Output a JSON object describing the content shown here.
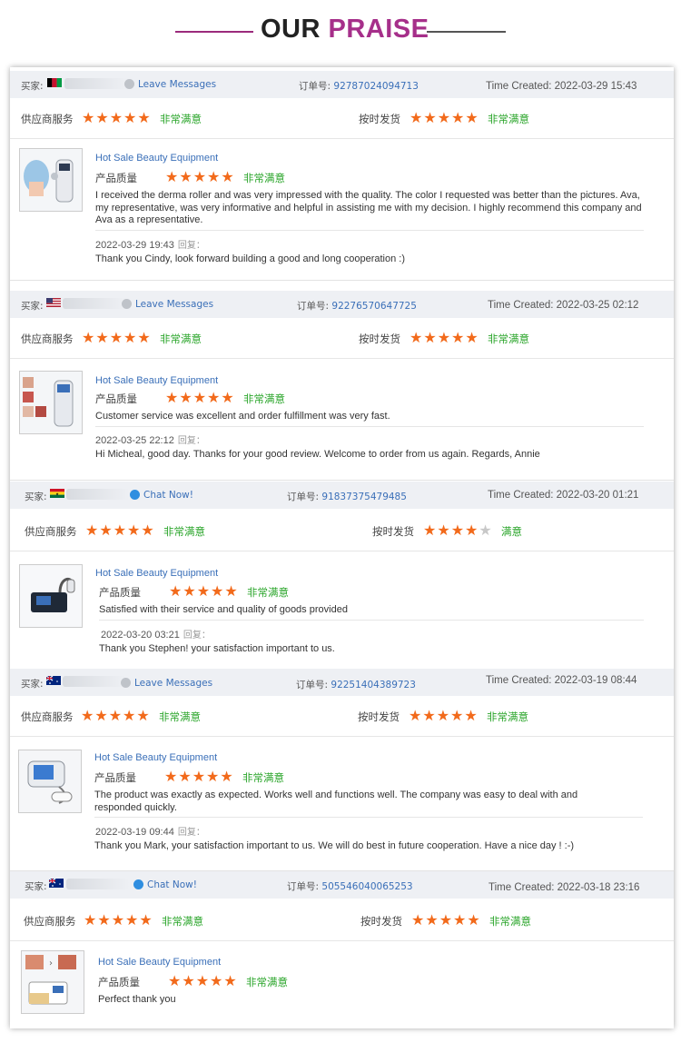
{
  "heading": {
    "word1": "OUR",
    "word2": "PRAISE"
  },
  "labels": {
    "buyer": "买家:",
    "order": "订单号:",
    "supplier_service": "供应商服务",
    "on_time": "按时发货",
    "quality": "产品质量",
    "reply": "回复："
  },
  "colors": {
    "star": "#f26a1b",
    "satisfied": "#2aa52a",
    "link": "#3a6fb8",
    "accent": "#a62f8a"
  },
  "reviews": [
    {
      "flag": "afghanistan-flag",
      "action": "Leave Messages",
      "order_no": "92787024094713",
      "time": "Time Created: 2022-03-29 15:43",
      "supplier_rating": 5,
      "supplier_text": "非常满意",
      "ontime_rating": 5,
      "ontime_text": "非常满意",
      "product": "Hot Sale Beauty Equipment",
      "quality_rating": 5,
      "quality_text": "非常满意",
      "comment": "I received the derma roller and was very impressed with the quality. The color I requested was better than the pictures. Ava, my representative, was very informative and helpful in assisting me with my decision. I highly recommend this company and Ava as a representative.",
      "reply_date": "2022-03-29 19:43",
      "reply": "Thank you Cindy, look forward building a good and long cooperation :)"
    },
    {
      "flag": "usa-flag",
      "action": "Leave Messages",
      "order_no": "92276570647725",
      "time": "Time Created: 2022-03-25 02:12",
      "supplier_rating": 5,
      "supplier_text": "非常满意",
      "ontime_rating": 5,
      "ontime_text": "非常满意",
      "product": "Hot Sale Beauty Equipment",
      "quality_rating": 5,
      "quality_text": "非常满意",
      "comment": "Customer service was excellent and order fulfillment was very fast.",
      "reply_date": "2022-03-25 22:12",
      "reply": "Hi Micheal, good day. Thanks for your good review. Welcome to order from us again. Regards, Annie"
    },
    {
      "flag": "ghana-flag",
      "action": "Chat Now!",
      "order_no": "91837375479485",
      "time": "Time Created: 2022-03-20 01:21",
      "supplier_rating": 5,
      "supplier_text": "非常满意",
      "ontime_rating": 4,
      "ontime_text": "满意",
      "product": "Hot Sale Beauty Equipment",
      "quality_rating": 5,
      "quality_text": "非常满意",
      "comment": "Satisfied with their service and quality of goods provided",
      "reply_date": "2022-03-20 03:21",
      "reply": "Thank you Stephen! your satisfaction important to us."
    },
    {
      "flag": "australia-flag",
      "action": "Leave Messages",
      "order_no": "92251404389723",
      "time": "Time Created: 2022-03-19 08:44",
      "supplier_rating": 5,
      "supplier_text": "非常满意",
      "ontime_rating": 5,
      "ontime_text": "非常满意",
      "product": "Hot Sale Beauty Equipment",
      "quality_rating": 5,
      "quality_text": "非常满意",
      "comment": "The product was exactly as expected. Works well and functions well. The company was easy to deal with and responded quickly.",
      "reply_date": "2022-03-19 09:44",
      "reply": "Thank you Mark, your satisfaction important to us. We will do best in future cooperation. Have a nice day ! :-)"
    },
    {
      "flag": "australia-flag",
      "action": "Chat Now!",
      "order_no": "505546040065253",
      "time": "Time Created: 2022-03-18 23:16",
      "supplier_rating": 5,
      "supplier_text": "非常满意",
      "ontime_rating": 5,
      "ontime_text": "非常满意",
      "product": "Hot Sale Beauty Equipment",
      "quality_rating": 5,
      "quality_text": "非常满意",
      "comment": "Perfect thank you"
    }
  ]
}
